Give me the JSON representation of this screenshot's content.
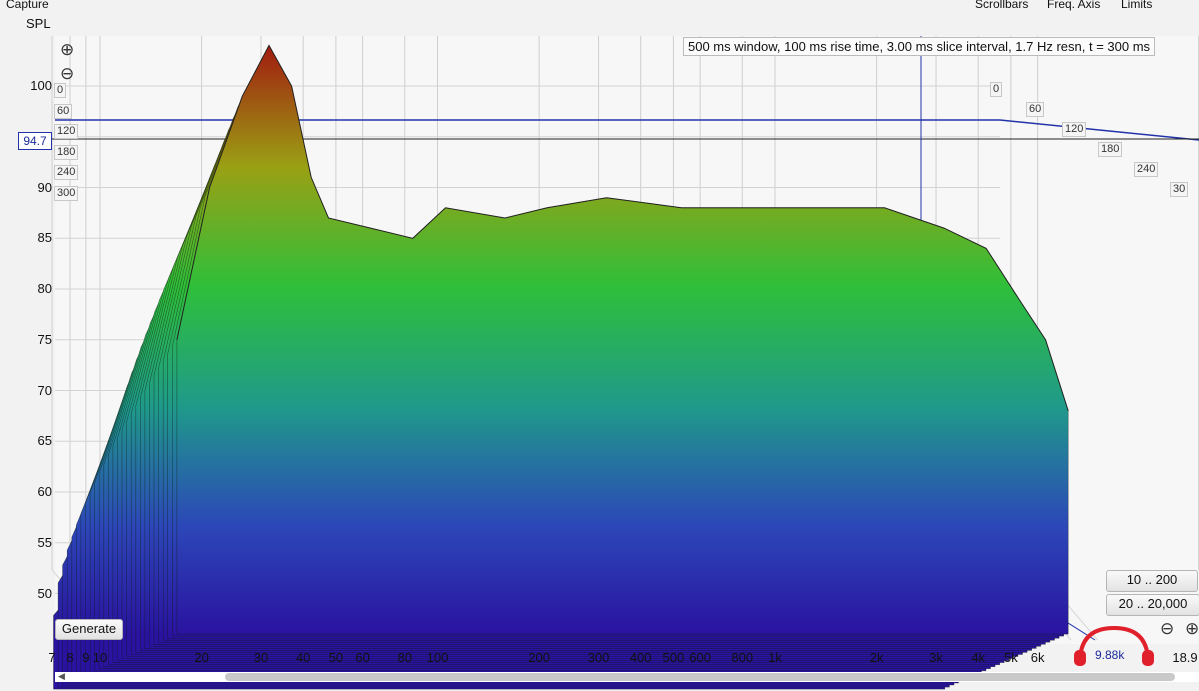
{
  "toolbar": {
    "capture": "Capture",
    "scrollbars": "Scrollbars",
    "freq_axis": "Freq. Axis",
    "limits": "Limits"
  },
  "info_text": "500 ms window, 100 ms rise time, 3.00 ms slice interval, 1.7 Hz resn, t = 300 ms",
  "cursor_value": "94.7",
  "cursor_freq": "9.88k",
  "buttons": {
    "generate": "Generate",
    "range_low": "10 .. 200",
    "range_full": "20 .. 20,000"
  },
  "colors": {
    "high": "#a21010",
    "mid": "#2fbf3a",
    "low": "#2a13a0",
    "cursor": "#1a2a9a"
  },
  "icons": {
    "zoom_in": "zoom-in-icon",
    "zoom_out": "zoom-out-icon"
  },
  "chart_data": {
    "type": "area",
    "subtype": "waterfall",
    "ylabel": "SPL",
    "ylim": [
      46,
      106
    ],
    "y_ticks": [
      "100",
      "95",
      "90",
      "85",
      "80",
      "75",
      "70",
      "65",
      "60",
      "55",
      "50"
    ],
    "x_scale": "log",
    "xlim": [
      7,
      18000
    ],
    "x_ticks": [
      {
        "v": 7,
        "label": "7"
      },
      {
        "v": 8,
        "label": "8"
      },
      {
        "v": 9,
        "label": "9"
      },
      {
        "v": 10,
        "label": "10"
      },
      {
        "v": 20,
        "label": "20"
      },
      {
        "v": 30,
        "label": "30"
      },
      {
        "v": 40,
        "label": "40"
      },
      {
        "v": 50,
        "label": "50"
      },
      {
        "v": 60,
        "label": "60"
      },
      {
        "v": 80,
        "label": "80"
      },
      {
        "v": 100,
        "label": "100"
      },
      {
        "v": 200,
        "label": "200"
      },
      {
        "v": 300,
        "label": "300"
      },
      {
        "v": 400,
        "label": "400"
      },
      {
        "v": 500,
        "label": "500"
      },
      {
        "v": 600,
        "label": "600"
      },
      {
        "v": 800,
        "label": "800"
      },
      {
        "v": 1000,
        "label": "1k"
      },
      {
        "v": 2000,
        "label": "2k"
      },
      {
        "v": 3000,
        "label": "3k"
      },
      {
        "v": 4000,
        "label": "4k"
      },
      {
        "v": 5000,
        "label": "5k"
      },
      {
        "v": 6000,
        "label": "6k"
      },
      {
        "v": 18000,
        "label": "18.9"
      }
    ],
    "time_labels_left": [
      "0",
      "60",
      "120",
      "180",
      "240",
      "300"
    ],
    "time_labels_right": [
      "0",
      "60",
      "120",
      "180",
      "240",
      "30"
    ],
    "time_unit": "ms",
    "first_slice": [
      {
        "f": 16,
        "db": 75
      },
      {
        "f": 20,
        "db": 90
      },
      {
        "f": 25,
        "db": 99
      },
      {
        "f": 30,
        "db": 104
      },
      {
        "f": 35,
        "db": 100
      },
      {
        "f": 40,
        "db": 91
      },
      {
        "f": 45,
        "db": 87
      },
      {
        "f": 60,
        "db": 86
      },
      {
        "f": 80,
        "db": 85
      },
      {
        "f": 100,
        "db": 88
      },
      {
        "f": 150,
        "db": 87
      },
      {
        "f": 200,
        "db": 88
      },
      {
        "f": 300,
        "db": 89
      },
      {
        "f": 500,
        "db": 88
      },
      {
        "f": 800,
        "db": 88
      },
      {
        "f": 1000,
        "db": 88
      },
      {
        "f": 2000,
        "db": 88
      },
      {
        "f": 3000,
        "db": 86
      },
      {
        "f": 4000,
        "db": 84
      },
      {
        "f": 5000,
        "db": 79
      },
      {
        "f": 6000,
        "db": 75
      },
      {
        "f": 7000,
        "db": 68
      }
    ]
  }
}
